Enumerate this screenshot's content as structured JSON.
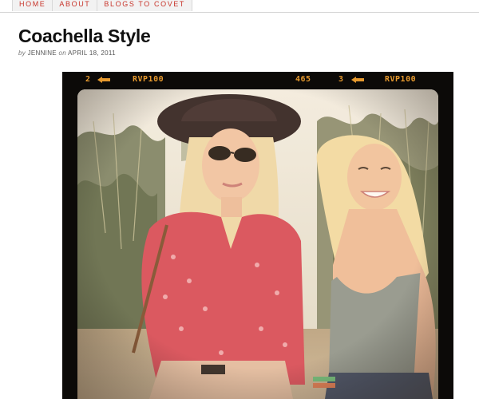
{
  "nav": {
    "items": [
      {
        "label": "HOME"
      },
      {
        "label": "ABOUT"
      },
      {
        "label": "BLOGS TO COVET"
      }
    ]
  },
  "post": {
    "title": "Coachella Style",
    "meta": {
      "by": "by",
      "author": "JENNINE",
      "on": "on",
      "date": "APRIL 18, 2011"
    }
  },
  "photo": {
    "film_strip": {
      "frame_left": "2",
      "brand_left": "RVP100",
      "counter": "465",
      "frame_right": "3",
      "brand_right": "RVP100"
    },
    "colors": {
      "film_text": "#e79a2e",
      "frame": "#0c0a08",
      "blouse": "#d84a5a",
      "tank_top": "#8e9791",
      "hair": "#f3dfa8"
    }
  }
}
